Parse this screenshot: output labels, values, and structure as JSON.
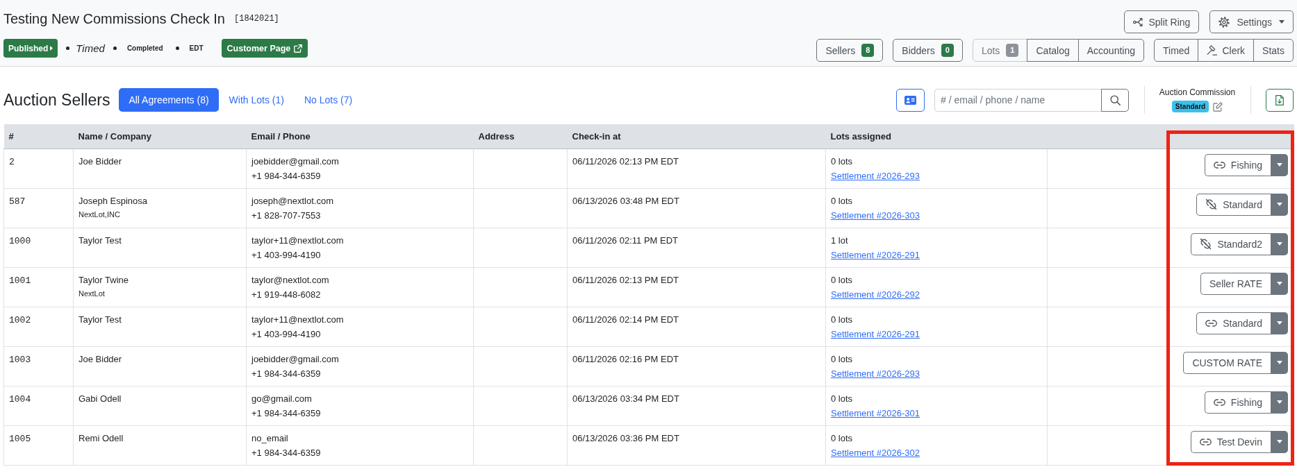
{
  "header": {
    "title": "Testing New Commissions Check In",
    "auction_id": "[1842021]",
    "status_button": {
      "label": "Published"
    },
    "meta": [
      {
        "kind": "italic",
        "text": "Timed"
      },
      {
        "kind": "small",
        "text": "Completed"
      },
      {
        "kind": "small",
        "text": "EDT"
      }
    ],
    "customer_page_button": {
      "label": "Customer Page"
    }
  },
  "toolbar": {
    "split_ring_button": {
      "label": "Split Ring"
    },
    "settings_button": {
      "label": "Settings"
    },
    "nav_groups": [
      {
        "buttons": [
          {
            "label": "Sellers",
            "kind": "plain",
            "disabled": false,
            "badge": {
              "text": "8",
              "color": "#2b7a47"
            }
          }
        ]
      },
      {
        "buttons": [
          {
            "label": "Bidders",
            "kind": "plain",
            "disabled": false,
            "badge": {
              "text": "0",
              "color": "#2b7a47"
            }
          }
        ]
      },
      {
        "buttons": [
          {
            "label": "Lots",
            "kind": "plain",
            "disabled": true,
            "badge": {
              "text": "1",
              "color": "#8d9399"
            }
          },
          {
            "label": "Catalog",
            "kind": "plain",
            "disabled": false
          },
          {
            "label": "Accounting",
            "kind": "plain",
            "disabled": false
          }
        ]
      },
      {
        "buttons": [
          {
            "label": "Timed",
            "kind": "plain",
            "disabled": false
          },
          {
            "label": "Clerk",
            "kind": "icon",
            "disabled": false
          },
          {
            "label": "Stats",
            "kind": "plain",
            "disabled": false
          }
        ]
      }
    ]
  },
  "sellers": {
    "heading": "Auction Sellers",
    "tabs": [
      {
        "label": "All Agreements (8)",
        "selected": true
      },
      {
        "label": "With Lots (1)",
        "selected": false
      },
      {
        "label": "No Lots (7)",
        "selected": false
      }
    ],
    "search": {
      "placeholder": "# / email / phone / name"
    },
    "commission": {
      "label": "Auction Commission",
      "badge": "Standard"
    }
  },
  "table": {
    "columns": [
      "#",
      "Name / Company",
      "Email / Phone",
      "Address",
      "Check-in at",
      "Lots assigned"
    ],
    "commission_column_highlighted": true,
    "rows": [
      {
        "number": "2",
        "name": "Joe Bidder",
        "email": "joebidder@gmail.com",
        "phone": "+1 984-344-6359",
        "check_in": "06/11/2026 02:13 PM EDT",
        "lots": "0 lots",
        "settlement": "Settlement #2026-293",
        "commission": {
          "label": "Fishing",
          "kind": "linked"
        }
      },
      {
        "number": "587",
        "name": "Joseph Espinosa",
        "company": "NextLot,INC",
        "email": "joseph@nextlot.com",
        "phone": "+1 828-707-7553",
        "check_in": "06/13/2026 03:48 PM EDT",
        "lots": "0 lots",
        "settlement": "Settlement #2026-303",
        "commission": {
          "label": "Standard",
          "kind": "unlinked"
        }
      },
      {
        "number": "1000",
        "name": "Taylor Test",
        "email": "taylor+11@nextlot.com",
        "phone": "+1 403-994-4190",
        "check_in": "06/11/2026 02:11 PM EDT",
        "lots": "1 lot",
        "settlement": "Settlement #2026-291",
        "commission": {
          "label": "Standard2",
          "kind": "unlinked"
        }
      },
      {
        "number": "1001",
        "name": "Taylor Twine",
        "company": "NextLot",
        "email": "taylor@nextlot.com",
        "phone": "+1 919-448-6082",
        "check_in": "06/11/2026 02:13 PM EDT",
        "lots": "0 lots",
        "settlement": "Settlement #2026-292",
        "commission": {
          "label": "Seller RATE",
          "kind": "custom"
        }
      },
      {
        "number": "1002",
        "name": "Taylor Test",
        "email": "taylor+11@nextlot.com",
        "phone": "+1 403-994-4190",
        "check_in": "06/11/2026 02:14 PM EDT",
        "lots": "0 lots",
        "settlement": "Settlement #2026-291",
        "commission": {
          "label": "Standard",
          "kind": "linked"
        }
      },
      {
        "number": "1003",
        "name": "Joe Bidder",
        "email": "joebidder@gmail.com",
        "phone": "+1 984-344-6359",
        "check_in": "06/11/2026 02:16 PM EDT",
        "lots": "0 lots",
        "settlement": "Settlement #2026-293",
        "commission": {
          "label": "CUSTOM RATE",
          "kind": "custom"
        }
      },
      {
        "number": "1004",
        "name": "Gabi Odell",
        "email": "go@gmail.com",
        "phone": "+1 984-344-6359",
        "check_in": "06/13/2026 03:34 PM EDT",
        "lots": "0 lots",
        "settlement": "Settlement #2026-301",
        "commission": {
          "label": "Fishing",
          "kind": "linked"
        }
      },
      {
        "number": "1005",
        "name": "Remi Odell",
        "email": "no_email",
        "phone": "+1 984-344-6359",
        "check_in": "06/13/2026 03:36 PM EDT",
        "lots": "0 lots",
        "settlement": "Settlement #2026-302",
        "commission": {
          "label": "Test Devin",
          "kind": "linked"
        }
      }
    ]
  }
}
